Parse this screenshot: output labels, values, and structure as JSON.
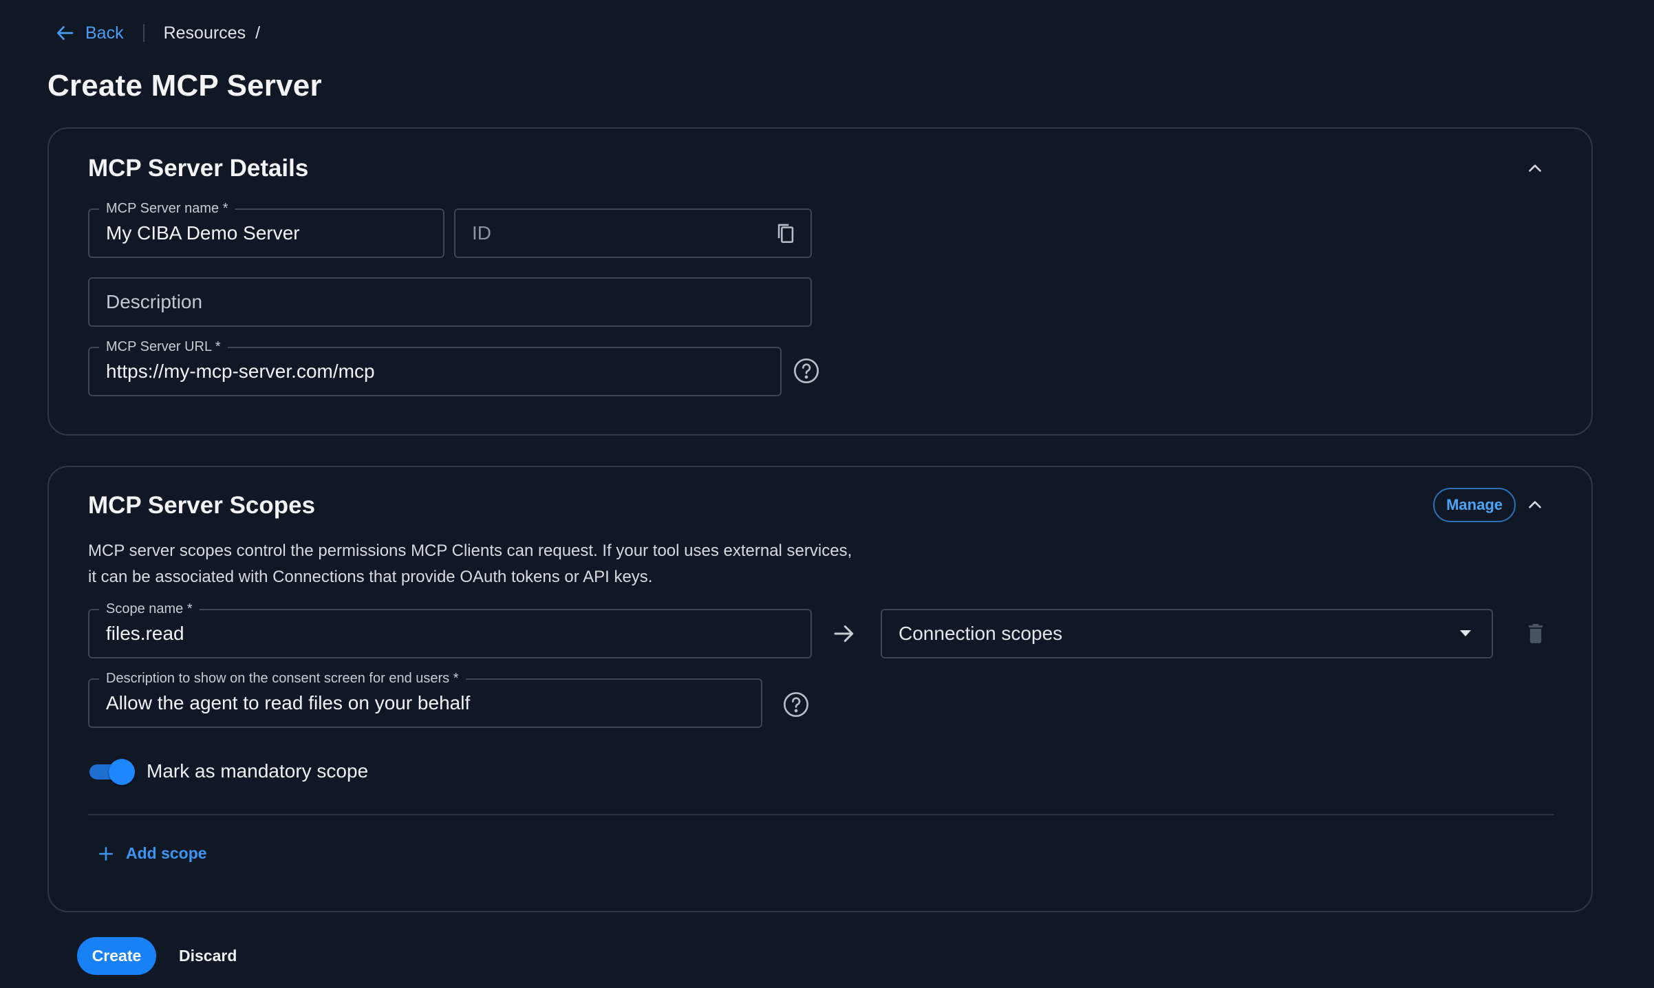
{
  "breadcrumb": {
    "back_label": "Back",
    "items": [
      "Resources"
    ],
    "separator": "/"
  },
  "page": {
    "title": "Create MCP Server"
  },
  "details": {
    "title": "MCP Server Details",
    "name_field": {
      "label": "MCP Server name *",
      "value": "My CIBA Demo Server"
    },
    "id_field": {
      "placeholder": "ID"
    },
    "description_field": {
      "placeholder": "Description"
    },
    "url_field": {
      "label": "MCP Server URL *",
      "value": "https://my-mcp-server.com/mcp"
    }
  },
  "scopes": {
    "title": "MCP Server Scopes",
    "manage_label": "Manage",
    "description_line1": "MCP server scopes control the permissions MCP Clients can request. If your tool uses external services,",
    "description_line2": "it can be associated with Connections that provide OAuth tokens or API keys.",
    "scope_name_field": {
      "label": "Scope name *",
      "value": "files.read"
    },
    "connection_select": {
      "placeholder": "Connection scopes"
    },
    "consent_field": {
      "label": "Description to show on the consent screen for end users *",
      "value": "Allow the agent to read files on your behalf"
    },
    "mandatory_toggle": {
      "label": "Mark as mandatory scope",
      "checked": true
    },
    "add_scope_label": "Add scope"
  },
  "actions": {
    "create_label": "Create",
    "discard_label": "Discard"
  },
  "colors": {
    "background": "#0f1824",
    "accent": "#1781f5",
    "link": "#4a9bf2",
    "border": "#3b4656"
  },
  "icons": [
    "arrow-left-icon",
    "chevron-up-icon",
    "copy-icon",
    "help-circle-icon",
    "arrow-right-icon",
    "caret-down-icon",
    "trash-icon",
    "plus-icon"
  ]
}
